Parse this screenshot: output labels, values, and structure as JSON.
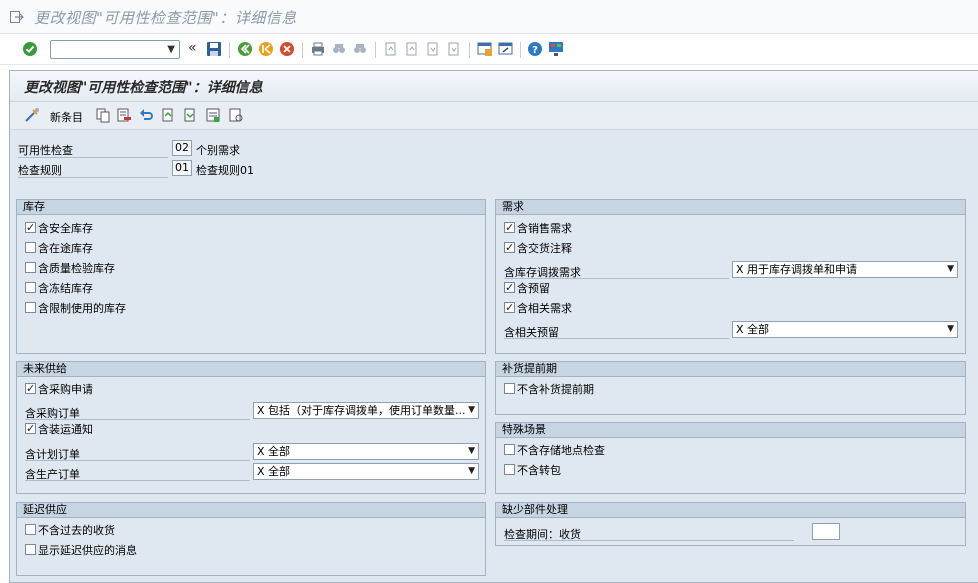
{
  "window": {
    "title": "更改视图\"可用性检查范围\"：详细信息"
  },
  "std_toolbar": {
    "command_value": ""
  },
  "screen": {
    "title": "更改视图\"可用性检查范围\"：详细信息"
  },
  "app_toolbar": {
    "new_entries": "新条目"
  },
  "header": {
    "availability_check": {
      "label": "可用性检查",
      "code": "02",
      "desc": "个别需求"
    },
    "checking_rule": {
      "label": "检查规则",
      "code": "01",
      "desc": "检查规则01"
    }
  },
  "stock": {
    "title": "库存",
    "items": [
      {
        "label": "含安全库存",
        "checked": true
      },
      {
        "label": "含在途库存",
        "checked": false
      },
      {
        "label": "含质量检验库存",
        "checked": false
      },
      {
        "label": "含冻结库存",
        "checked": false
      },
      {
        "label": "含限制使用的库存",
        "checked": false
      }
    ]
  },
  "requirements": {
    "title": "需求",
    "sales_req": {
      "label": "含销售需求",
      "checked": true
    },
    "delivery_note": {
      "label": "含交货注释",
      "checked": true
    },
    "stock_transfer_req": {
      "label": "含库存调拨需求",
      "value": "X 用于库存调拨单和申请"
    },
    "reservations": {
      "label": "含预留",
      "checked": true
    },
    "dependent_req": {
      "label": "含相关需求",
      "checked": true
    },
    "dependent_reservations": {
      "label": "含相关预留",
      "value": "X 全部"
    }
  },
  "future_supply": {
    "title": "未来供给",
    "purchase_req": {
      "label": "含采购申请",
      "checked": true
    },
    "purchase_orders": {
      "label": "含采购订单",
      "value": "X 包括（对于库存调拨单，使用订单数量..."
    },
    "shipping_notif": {
      "label": "含装运通知",
      "checked": true
    },
    "planned_orders": {
      "label": "含计划订单",
      "value": "X 全部"
    },
    "production_orders": {
      "label": "含生产订单",
      "value": "X 全部"
    }
  },
  "replenishment": {
    "title": "补货提前期",
    "exclude": {
      "label": "不含补货提前期",
      "checked": false
    }
  },
  "special": {
    "title": "特殊场景",
    "no_storage_check": {
      "label": "不含存储地点检查",
      "checked": false
    },
    "no_subcontract": {
      "label": "不含转包",
      "checked": false
    }
  },
  "delayed": {
    "title": "延迟供应",
    "no_past_receipts": {
      "label": "不含过去的收货",
      "checked": false
    },
    "show_message": {
      "label": "显示延迟供应的消息",
      "checked": false
    }
  },
  "missing_parts": {
    "title": "缺少部件处理",
    "check_period": {
      "label": "检查期间：收货",
      "value": ""
    }
  }
}
